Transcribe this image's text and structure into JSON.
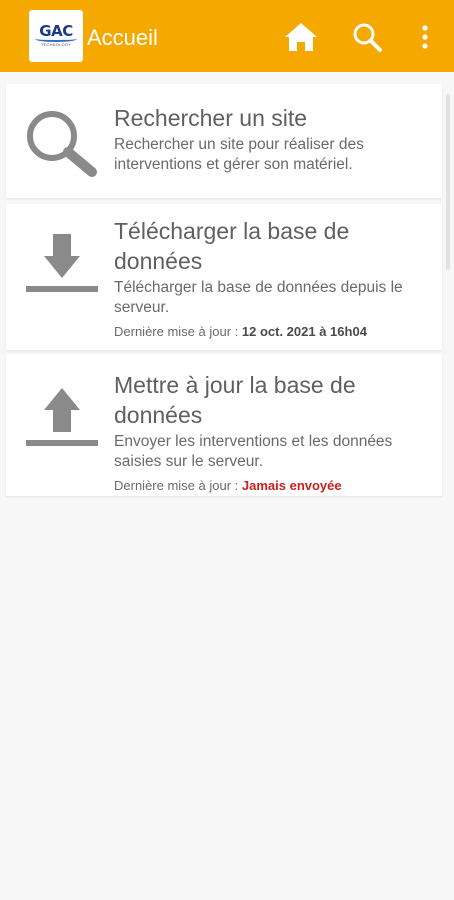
{
  "appbar": {
    "title": "Accueil",
    "logo_text": "GAC",
    "logo_subtext": "TECHNOLOGY",
    "color": "#f5a800",
    "icons": [
      "home-icon",
      "search-icon",
      "more-vert-icon"
    ]
  },
  "cards": [
    {
      "icon": "search-icon",
      "title": "Rechercher un site",
      "description": "Rechercher un site pour réaliser des interventions et gérer son matériel."
    },
    {
      "icon": "download-icon",
      "title": "Télécharger la base de données",
      "description": "Télécharger la base de données depuis le serveur.",
      "update_label": "Dernière mise à jour : ",
      "update_value": "12 oct. 2021 à 16h04"
    },
    {
      "icon": "upload-icon",
      "title": "Mettre à jour la base de données",
      "description": "Envoyer les interventions et les données saisies sur le serveur.",
      "update_label": "Dernière mise à jour : ",
      "update_value": "Jamais envoyée",
      "update_value_color": "#cc1f1f"
    }
  ]
}
